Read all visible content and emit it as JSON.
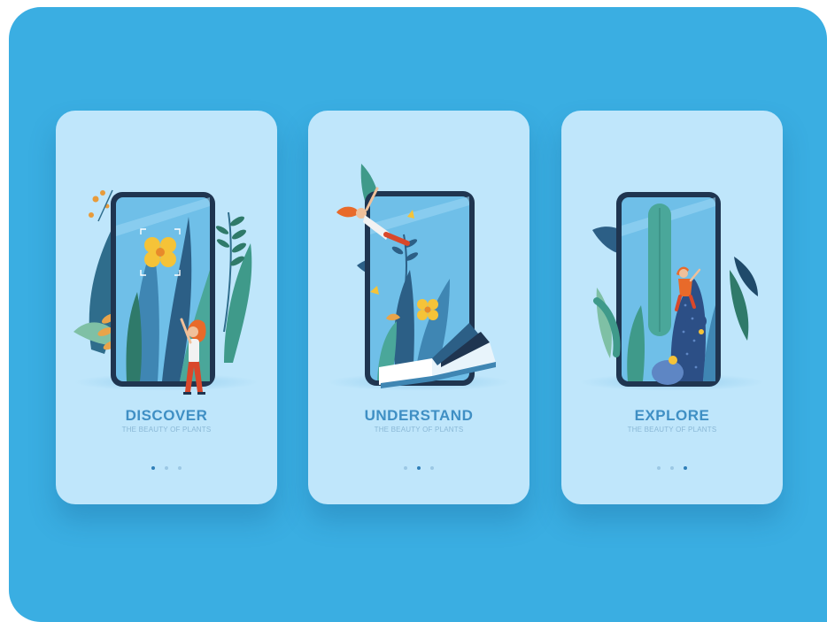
{
  "colors": {
    "background": "#3aaee2",
    "card": "#bfe6fb",
    "title": "#3f8fc4",
    "subtitle": "#8ab8d6",
    "dot_inactive": "#9cc8e4",
    "dot_active": "#2f7fb8",
    "phone_frame": "#1f3550"
  },
  "screens": [
    {
      "title": "DISCOVER",
      "subtitle": "THE BEAUTY OF PLANTS",
      "illustration": "phone-with-flower-and-woman-illustration",
      "pagination": {
        "count": 3,
        "active": 1
      }
    },
    {
      "title": "UNDERSTAND",
      "subtitle": "THE BEAUTY OF PLANTS",
      "illustration": "phone-with-book-and-flying-woman-illustration",
      "pagination": {
        "count": 3,
        "active": 2
      }
    },
    {
      "title": "EXPLORE",
      "subtitle": "THE BEAUTY OF PLANTS",
      "illustration": "phone-with-cactus-and-climber-illustration",
      "pagination": {
        "count": 3,
        "active": 3
      }
    }
  ]
}
